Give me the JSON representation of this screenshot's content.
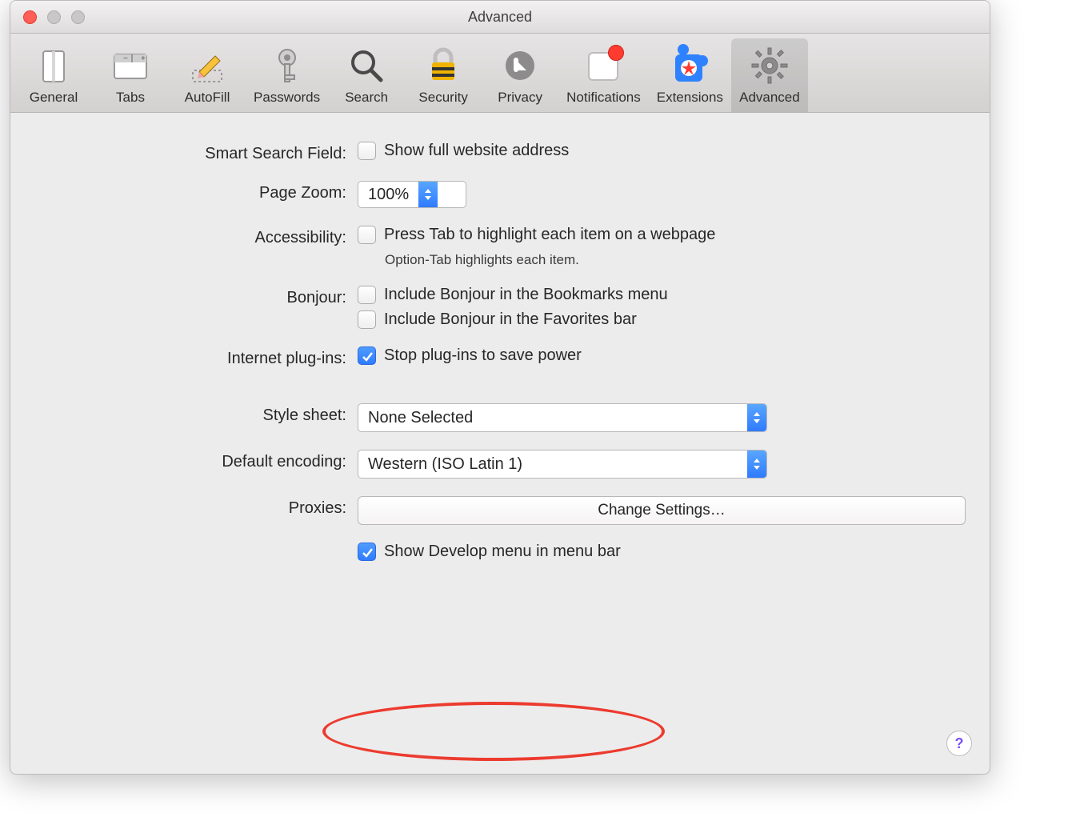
{
  "window": {
    "title": "Advanced"
  },
  "toolbar": {
    "tabs": [
      {
        "id": "general",
        "label": "General"
      },
      {
        "id": "tabs",
        "label": "Tabs"
      },
      {
        "id": "autofill",
        "label": "AutoFill"
      },
      {
        "id": "passwords",
        "label": "Passwords"
      },
      {
        "id": "search",
        "label": "Search"
      },
      {
        "id": "security",
        "label": "Security"
      },
      {
        "id": "privacy",
        "label": "Privacy"
      },
      {
        "id": "notifications",
        "label": "Notifications",
        "badge": true
      },
      {
        "id": "extensions",
        "label": "Extensions"
      },
      {
        "id": "advanced",
        "label": "Advanced",
        "active": true
      }
    ]
  },
  "form": {
    "smart_search": {
      "label": "Smart Search Field:",
      "show_full_url": {
        "checked": false,
        "label": "Show full website address"
      }
    },
    "page_zoom": {
      "label": "Page Zoom:",
      "value": "100%"
    },
    "accessibility": {
      "label": "Accessibility:",
      "press_tab": {
        "checked": false,
        "label": "Press Tab to highlight each item on a webpage"
      },
      "hint": "Option-Tab highlights each item."
    },
    "bonjour": {
      "label": "Bonjour:",
      "bookmarks": {
        "checked": false,
        "label": "Include Bonjour in the Bookmarks menu"
      },
      "favorites": {
        "checked": false,
        "label": "Include Bonjour in the Favorites bar"
      }
    },
    "plugins": {
      "label": "Internet plug-ins:",
      "stop_plugins": {
        "checked": true,
        "label": "Stop plug-ins to save power"
      }
    },
    "style_sheet": {
      "label": "Style sheet:",
      "value": "None Selected"
    },
    "default_encoding": {
      "label": "Default encoding:",
      "value": "Western (ISO Latin 1)"
    },
    "proxies": {
      "label": "Proxies:",
      "button": "Change Settings…"
    },
    "show_develop": {
      "checked": true,
      "label": "Show Develop menu in menu bar"
    }
  },
  "help": "?"
}
